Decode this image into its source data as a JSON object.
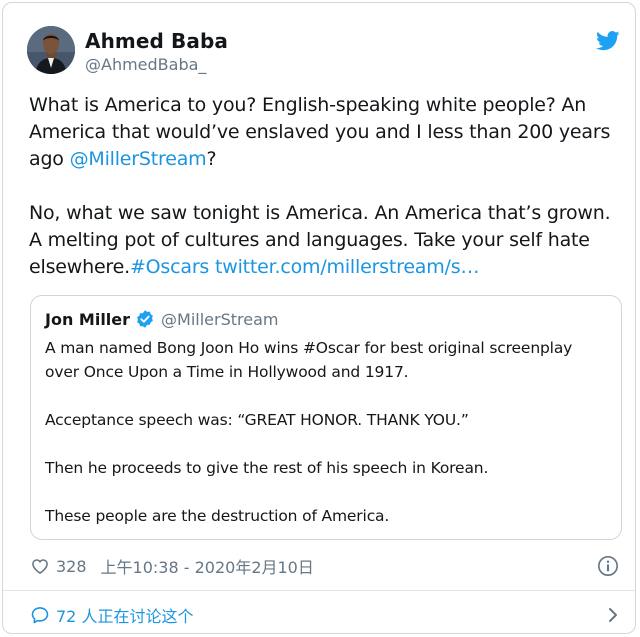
{
  "author": {
    "name": "Ahmed Baba",
    "handle": "@AhmedBaba_",
    "avatar": "profile-photo"
  },
  "icons": {
    "brand": "twitter-bird-icon",
    "verified": "verified-badge-icon",
    "like": "heart-icon",
    "info": "info-icon",
    "discussion": "speech-bubble-icon",
    "expand": "chevron-right-icon"
  },
  "colors": {
    "brand_blue": "#1da1f2",
    "link_blue": "#1b95e0",
    "text": "#14171a",
    "muted": "#657786",
    "border": "#ccd6dd"
  },
  "tweet": {
    "paragraph1": {
      "text": "What is America to you? English-speaking white people? An America that would’ve enslaved you and I less than 200 years ago ",
      "mention": "@MillerStream",
      "end": "?"
    },
    "paragraph2": {
      "text": "No, what we saw tonight is America. An America that’s grown. A melting pot of cultures and languages. Take your self hate elsewhere.",
      "hashtag": "#Oscars",
      "link": "twitter.com/millerstream/s…"
    }
  },
  "quoted_tweet": {
    "name": "Jon Miller",
    "handle": "@MillerStream",
    "paragraphs": [
      "A man named Bong Joon Ho wins #Oscar for best original screenplay over Once Upon a Time in Hollywood and 1917.",
      "Acceptance speech was: “GREAT HONOR. THANK YOU.”",
      "Then he proceeds to give the rest of his speech in Korean.",
      "These people are the destruction of America."
    ]
  },
  "meta": {
    "like_count": "328",
    "timestamp": "上午10:38 - 2020年2月10日"
  },
  "discussion": {
    "label": "72 人正在讨论这个"
  }
}
